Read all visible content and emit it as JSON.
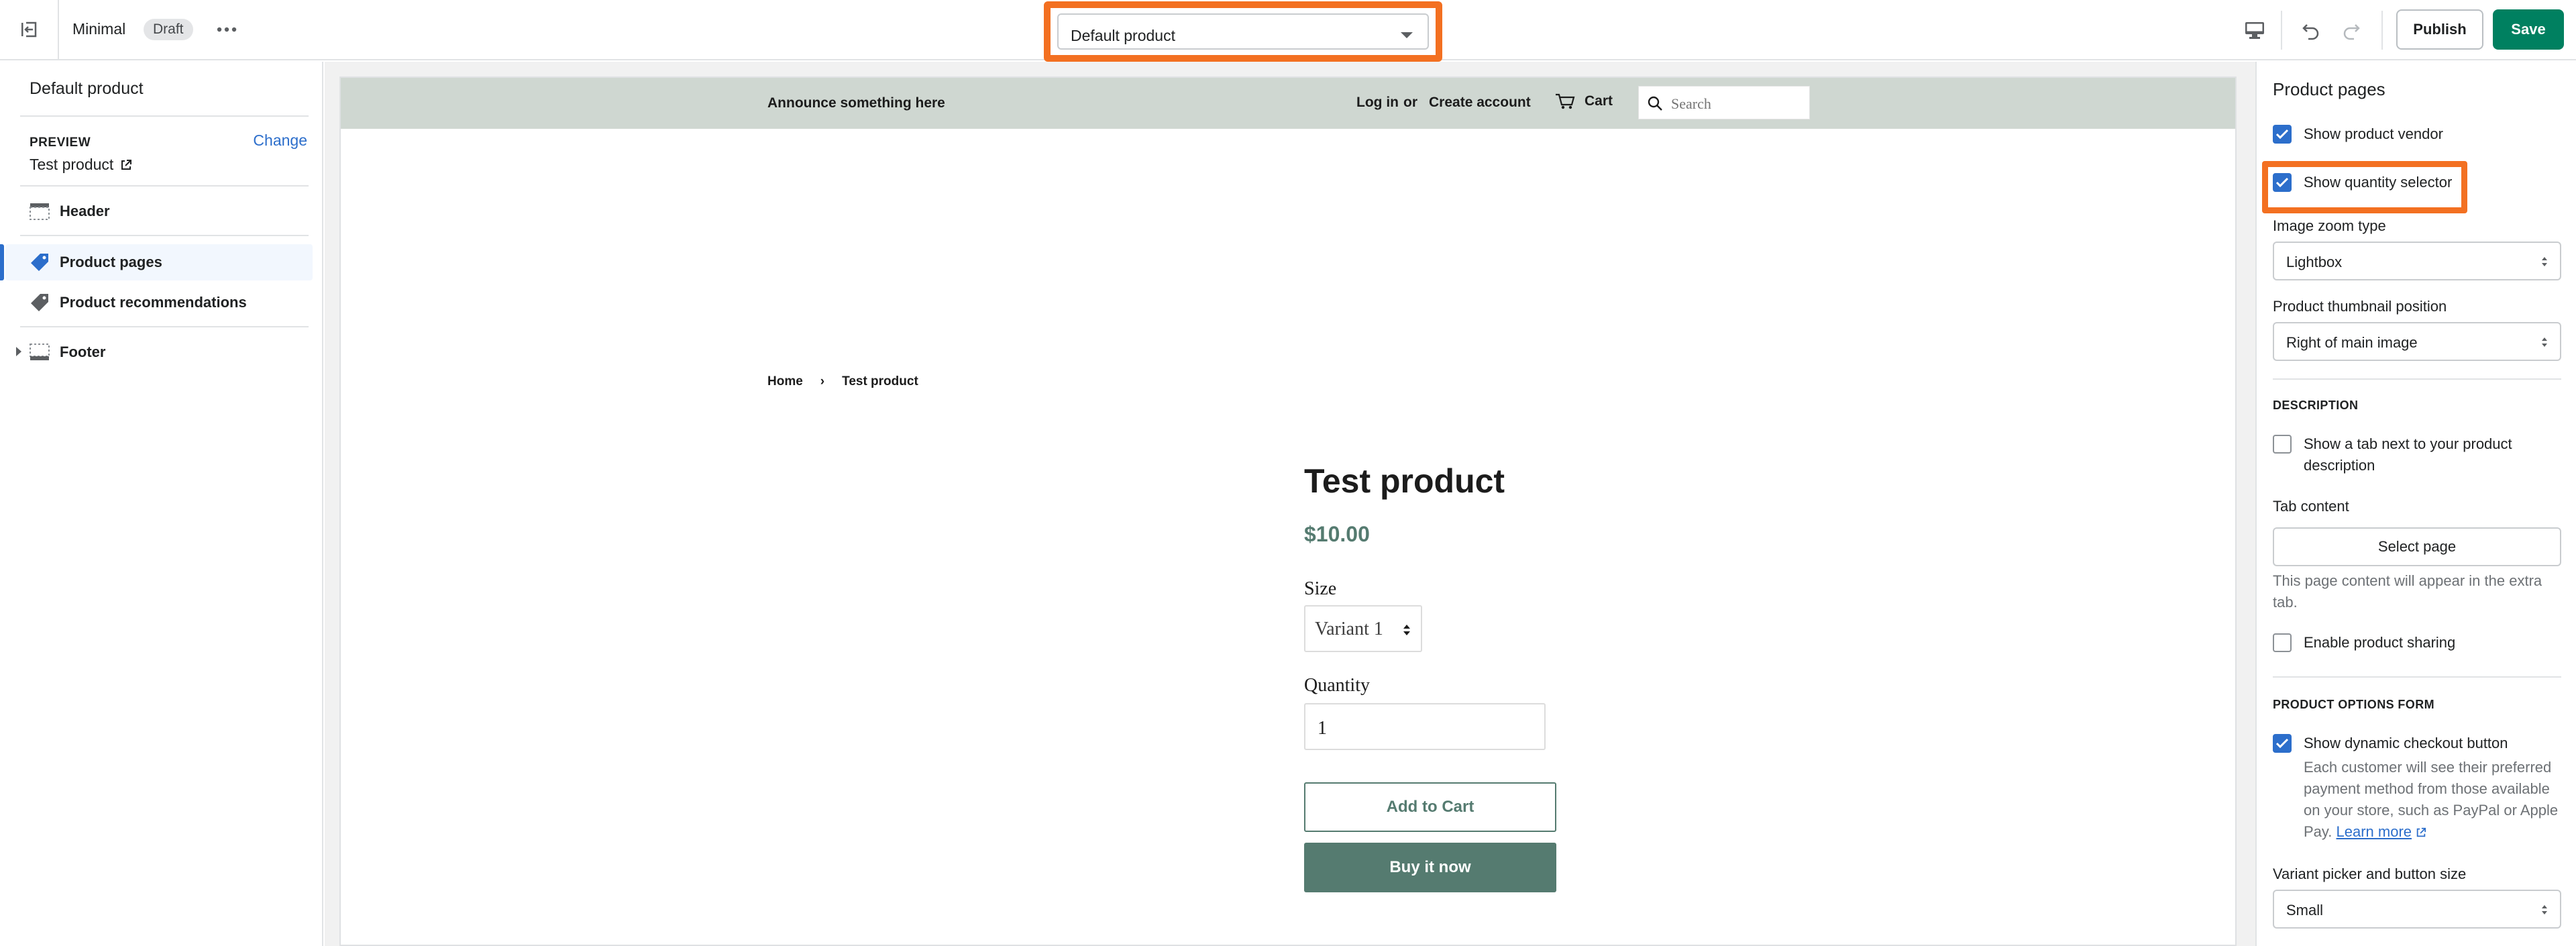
{
  "topbar": {
    "theme_name": "Minimal",
    "status_badge": "Draft",
    "template_selector": "Default product",
    "publish_label": "Publish",
    "save_label": "Save"
  },
  "sidebar_left": {
    "title": "Default product",
    "preview_label": "PREVIEW",
    "change_label": "Change",
    "preview_value": "Test product",
    "items": [
      {
        "label": "Header",
        "icon": "header-section-icon"
      },
      {
        "label": "Product pages",
        "icon": "tag-icon",
        "active": true
      },
      {
        "label": "Product recommendations",
        "icon": "tag-icon"
      },
      {
        "label": "Footer",
        "icon": "footer-section-icon"
      }
    ]
  },
  "store": {
    "announcement": "Announce something here",
    "login": "Log in",
    "or": "or",
    "create_account": "Create account",
    "cart": "Cart",
    "search_placeholder": "Search",
    "breadcrumb": [
      "Home",
      "›",
      "Test product"
    ],
    "product_title": "Test product",
    "price": "$10.00",
    "size_label": "Size",
    "variant": "Variant 1",
    "quantity_label": "Quantity",
    "quantity_value": "1",
    "add_to_cart": "Add to Cart",
    "buy_now": "Buy it now",
    "colors": {
      "announcement_bg": "#cfd7d1",
      "accent": "#557b70"
    }
  },
  "sidebar_right": {
    "title": "Product pages",
    "show_vendor": {
      "label": "Show product vendor",
      "checked": true
    },
    "show_quantity": {
      "label": "Show quantity selector",
      "checked": true
    },
    "image_zoom_label": "Image zoom type",
    "image_zoom_value": "Lightbox",
    "thumb_position_label": "Product thumbnail position",
    "thumb_position_value": "Right of main image",
    "description_heading": "DESCRIPTION",
    "show_tab": {
      "label_line1": "Show a tab next to your product",
      "label_line2": "description",
      "checked": false
    },
    "tab_content_label": "Tab content",
    "select_page": "Select page",
    "tab_help_line1": "This page content will appear in the extra",
    "tab_help_line2": "tab.",
    "enable_sharing": {
      "label": "Enable product sharing",
      "checked": false
    },
    "options_heading": "PRODUCT OPTIONS FORM",
    "dynamic_checkout": {
      "label": "Show dynamic checkout button",
      "checked": true
    },
    "dyn_help_line1": "Each customer will see their preferred",
    "dyn_help_line2": "payment method from those available",
    "dyn_help_line3": "on your store, such as PayPal or Apple",
    "dyn_help_line4": "Pay.",
    "learn_more": "Learn more",
    "variant_size_label": "Variant picker and button size",
    "variant_size_value": "Small"
  },
  "colors": {
    "primary_green": "#008060",
    "highlight_orange": "#f37021",
    "link_blue": "#2c6ecb"
  }
}
